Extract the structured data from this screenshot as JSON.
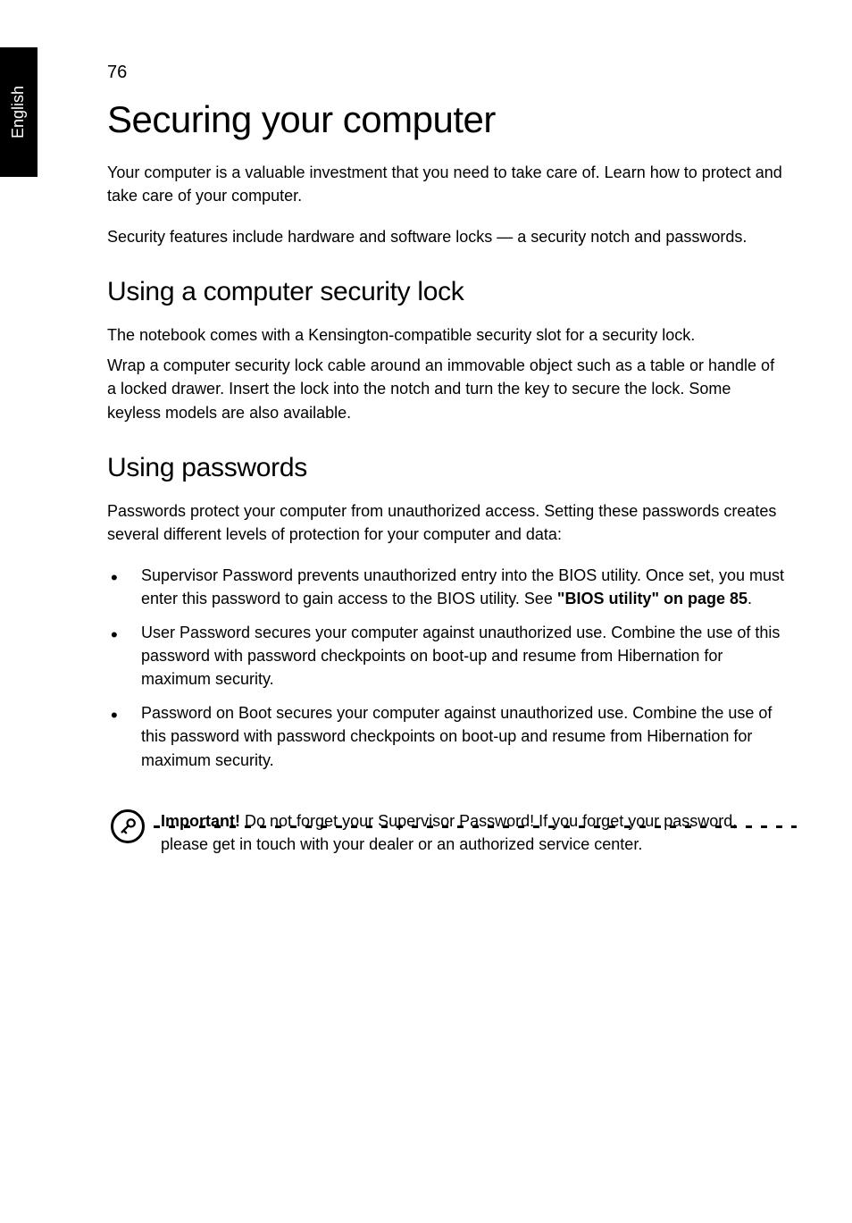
{
  "sideTab": {
    "label": "English"
  },
  "pageNumber": "76",
  "title": "Securing your computer",
  "intro1": "Your computer is a valuable investment that you need to take care of. Learn how to protect and take care of your computer.",
  "intro2": "Security features include hardware and software locks — a security notch and passwords.",
  "section1": {
    "heading": "Using a computer security lock",
    "para1": "The notebook comes with a Kensington-compatible security slot for a security lock.",
    "para2": "Wrap a computer security lock cable around an immovable object such as a table or handle of a locked drawer. Insert the lock into the notch and turn the key to secure the lock. Some keyless models are also available."
  },
  "section2": {
    "heading": "Using passwords",
    "para1": "Passwords protect your computer from unauthorized access. Setting these passwords creates several different levels of protection for your computer and data:",
    "bullets": [
      {
        "prefix": "Supervisor Password prevents unauthorized entry into the BIOS utility. Once set, you must enter this password to gain access to the BIOS utility. See ",
        "boldLink": "\"BIOS utility\" on page 85",
        "suffix": "."
      },
      {
        "text": "User Password secures your computer against unauthorized use. Combine the use of this password with password checkpoints on boot-up and resume from Hibernation for maximum security."
      },
      {
        "text": "Password on Boot secures your computer against unauthorized use. Combine the use of this password with password checkpoints on boot-up and resume from Hibernation for maximum security."
      }
    ],
    "note": {
      "boldPrefix": "Important!",
      "text": " Do not forget your Supervisor Password! If you forget your password, please get in touch with your dealer or an authorized service center."
    }
  }
}
